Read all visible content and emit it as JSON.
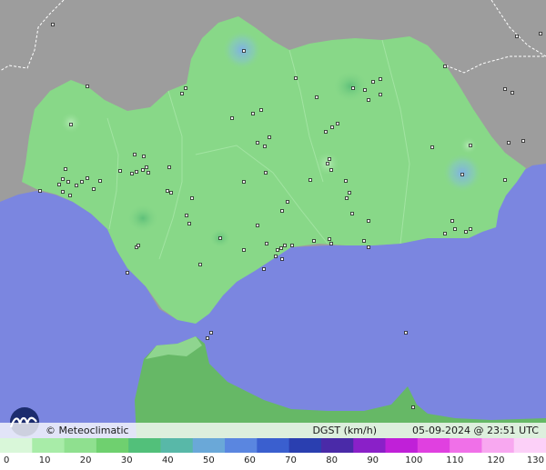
{
  "credit": "© Meteoclimatic",
  "parameter": "DGST (km/h)",
  "date": "05-09-2024",
  "time": "23:51 UTC",
  "at_sign": "@",
  "scale": {
    "ticks": [
      "0",
      "10",
      "20",
      "30",
      "40",
      "50",
      "60",
      "70",
      "80",
      "90",
      "100",
      "110",
      "120",
      "130"
    ],
    "min": 0,
    "max": 130,
    "colors": [
      "#d9f7d9",
      "#a8eca8",
      "#8fe08f",
      "#6fd06f",
      "#52c07a",
      "#58b8a8",
      "#6aa8d8",
      "#5a86e0",
      "#3a5fcf",
      "#2a3fb0",
      "#4a2aa8",
      "#8a20c8",
      "#c020d8",
      "#e040e0",
      "#f070e8",
      "#f8a8f0",
      "#fcd0f8"
    ]
  },
  "colors": {
    "sea": "#7b86e0",
    "land_foreign": "#9d9d9d",
    "land_region": "#88d888",
    "border": "#ffffff"
  },
  "stations": [
    [
      58,
      27
    ],
    [
      96,
      95
    ],
    [
      78,
      137
    ],
    [
      268,
      56
    ],
    [
      325,
      86
    ],
    [
      388,
      97
    ],
    [
      401,
      99
    ],
    [
      410,
      90
    ],
    [
      418,
      87
    ],
    [
      405,
      110
    ],
    [
      418,
      104
    ],
    [
      204,
      97
    ],
    [
      200,
      103
    ],
    [
      348,
      107
    ],
    [
      278,
      125
    ],
    [
      287,
      121
    ],
    [
      255,
      130
    ],
    [
      365,
      140
    ],
    [
      371,
      136
    ],
    [
      358,
      145
    ],
    [
      296,
      151
    ],
    [
      283,
      157
    ],
    [
      291,
      161
    ],
    [
      148,
      170
    ],
    [
      158,
      172
    ],
    [
      150,
      189
    ],
    [
      145,
      191
    ],
    [
      163,
      190
    ],
    [
      157,
      187
    ],
    [
      161,
      184
    ],
    [
      186,
      184
    ],
    [
      72,
      186
    ],
    [
      96,
      196
    ],
    [
      84,
      204
    ],
    [
      90,
      200
    ],
    [
      75,
      200
    ],
    [
      69,
      197
    ],
    [
      65,
      203
    ],
    [
      69,
      211
    ],
    [
      77,
      215
    ],
    [
      110,
      199
    ],
    [
      103,
      208
    ],
    [
      132,
      188
    ],
    [
      184,
      210
    ],
    [
      188,
      212
    ],
    [
      211,
      218
    ],
    [
      268,
      200
    ],
    [
      292,
      190
    ],
    [
      360,
      180
    ],
    [
      362,
      175
    ],
    [
      364,
      187
    ],
    [
      341,
      198
    ],
    [
      380,
      199
    ],
    [
      384,
      212
    ],
    [
      381,
      218
    ],
    [
      316,
      222
    ],
    [
      310,
      232
    ],
    [
      205,
      237
    ],
    [
      208,
      246
    ],
    [
      242,
      262
    ],
    [
      283,
      248
    ],
    [
      268,
      275
    ],
    [
      293,
      268
    ],
    [
      305,
      275
    ],
    [
      309,
      273
    ],
    [
      313,
      270
    ],
    [
      321,
      270
    ],
    [
      345,
      265
    ],
    [
      362,
      263
    ],
    [
      364,
      268
    ],
    [
      400,
      265
    ],
    [
      405,
      272
    ],
    [
      387,
      235
    ],
    [
      405,
      243
    ],
    [
      497,
      243
    ],
    [
      500,
      252
    ],
    [
      489,
      257
    ],
    [
      517,
      252
    ],
    [
      512,
      255
    ],
    [
      475,
      162
    ],
    [
      517,
      160
    ],
    [
      508,
      192
    ],
    [
      555,
      198
    ],
    [
      150,
      272
    ],
    [
      152,
      270
    ],
    [
      220,
      291
    ],
    [
      290,
      296
    ],
    [
      310,
      285
    ],
    [
      303,
      282
    ],
    [
      140,
      300
    ],
    [
      44,
      210
    ],
    [
      232,
      366
    ],
    [
      228,
      372
    ],
    [
      446,
      366
    ],
    [
      454,
      448
    ],
    [
      568,
      40
    ],
    [
      594,
      37
    ],
    [
      489,
      73
    ],
    [
      555,
      98
    ],
    [
      563,
      102
    ],
    [
      575,
      155
    ],
    [
      559,
      157
    ]
  ]
}
